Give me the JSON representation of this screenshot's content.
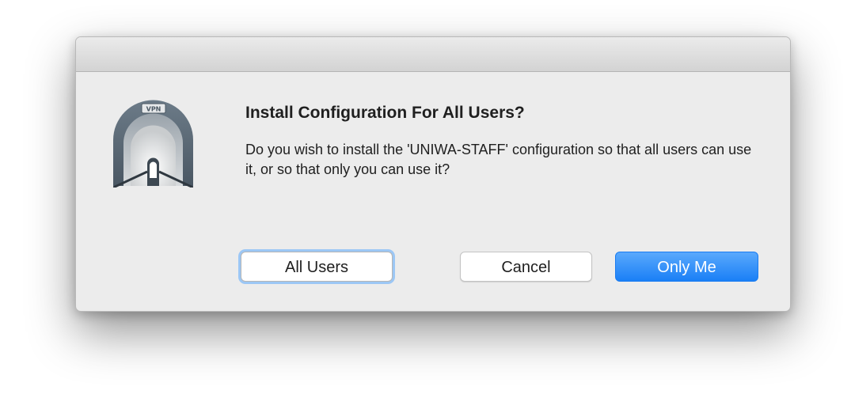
{
  "dialog": {
    "title": "Install Configuration For All Users?",
    "message": "Do you wish to install the 'UNIWA-STAFF' configuration so that all users can use it, or so that only you can use it?",
    "icon": {
      "name": "vpn-tunnel-icon",
      "label": "VPN"
    },
    "buttons": {
      "all_users": "All Users",
      "cancel": "Cancel",
      "only_me": "Only Me"
    },
    "accent_color": "#1a7ff6",
    "focus_ring_color": "#9cc7f5"
  }
}
